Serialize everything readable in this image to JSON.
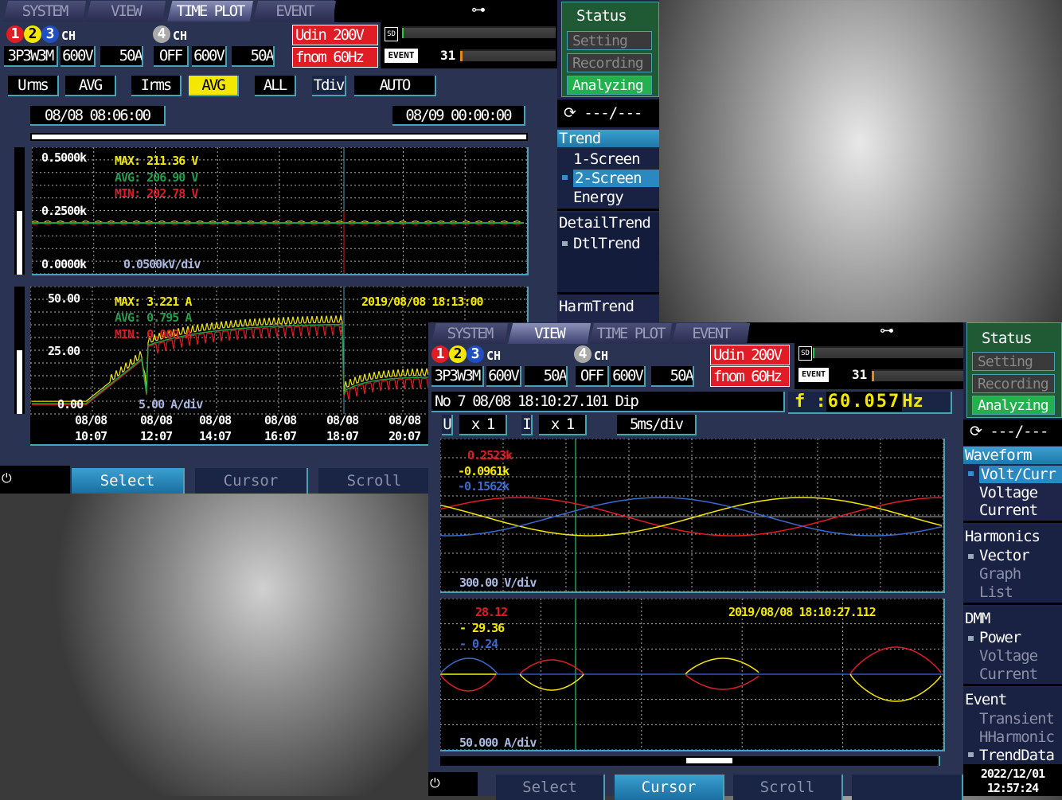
{
  "tabs": [
    "SYSTEM",
    "VIEW",
    "TIME PLOT",
    "EVENT"
  ],
  "channels": {
    "d1": "1",
    "d2": "2",
    "d3": "3",
    "d4": "4",
    "ch": "CH",
    "wiring": "3P3W3M",
    "voltage": "600V",
    "current": "50A",
    "ch4_wiring": "OFF",
    "ch4_voltage": "600V",
    "ch4_current": "50A"
  },
  "udin": "Udin 200V",
  "fnom": "fnom  60Hz",
  "sd": "SD",
  "event": "EVENT",
  "event_count": "31",
  "colors": {
    "red": "#e01c24",
    "yellow": "#f5e800",
    "blue": "#3a6ad0",
    "green": "#1fa04a"
  },
  "screen_a": {
    "controls": {
      "u": "Urms",
      "u_mode": "AVG",
      "i": "Irms",
      "i_mode": "AVG",
      "all": "ALL",
      "tdiv": "Tdiv",
      "tdiv_val": "AUTO"
    },
    "start": "08/08 08:06:00",
    "end": "08/09 00:00:00",
    "plot1": {
      "y_top": "0.5000k",
      "y_mid": "0.2500k",
      "y_bot": "0.0000k",
      "div": "0.0500kV/div",
      "max": "MAX: 211.36 V",
      "avg": "AVG: 206.90 V",
      "min": "MIN: 202.78 V"
    },
    "plot2": {
      "y_top": "50.00",
      "y_mid": "25.00",
      "y_bot": "0.00",
      "div": "5.00 A/div",
      "max": "MAX:  3.221 A",
      "avg": "AVG:  0.795 A",
      "min": "MIN:  0.000 A",
      "timestamp": "2019/08/08 18:13:00"
    },
    "xticks": [
      {
        "d": "08/08",
        "t": "10:07"
      },
      {
        "d": "08/08",
        "t": "12:07"
      },
      {
        "d": "08/08",
        "t": "14:07"
      },
      {
        "d": "08/08",
        "t": "16:07"
      },
      {
        "d": "08/08",
        "t": "18:07"
      },
      {
        "d": "08/08",
        "t": "20:07"
      }
    ],
    "buttons": [
      "Select",
      "Cursor",
      "Scroll"
    ],
    "side": {
      "status": "Status",
      "setting": "Setting",
      "recording": "Recording",
      "analyzing": "Analyzing",
      "counter": "---/---",
      "trend": "Trend",
      "s1": "1-Screen",
      "s2": "2-Screen",
      "energy": "Energy",
      "detail": "DetailTrend",
      "dtl": "DtlTrend",
      "harm": "HarmTrend"
    }
  },
  "screen_b": {
    "event_info": "No   7 08/08 18:10:27.101 Dip",
    "freq_label": "f :",
    "freq": "60.057",
    "freq_unit": "Hz",
    "u": "U",
    "u_scale": "x 1",
    "i": "I",
    "i_scale": "x 1",
    "tdiv": "5ms/div",
    "plot3": {
      "v1": "0.2523k",
      "v2": "-0.0961k",
      "v3": "-0.1562k",
      "div": "300.00 V/div"
    },
    "plot4": {
      "v1": "28.12",
      "v2": "- 29.36",
      "v3": "-  0.24",
      "div": "50.000 A/div",
      "timestamp": "2019/08/08 18:10:27.112"
    },
    "buttons": [
      "Select",
      "Cursor",
      "Scroll"
    ],
    "side": {
      "status": "Status",
      "setting": "Setting",
      "recording": "Recording",
      "analyzing": "Analyzing",
      "counter": "---/---",
      "waveform": "Waveform",
      "volt_curr": "Volt/Curr",
      "voltage": "Voltage",
      "current": "Current",
      "harmonics": "Harmonics",
      "vector": "Vector",
      "graph": "Graph",
      "list": "List",
      "dmm": "DMM",
      "power": "Power",
      "dmm_voltage": "Voltage",
      "dmm_current": "Current",
      "event": "Event",
      "transient": "Transient",
      "hharmonic": "HHarmonic",
      "trenddata": "TrendData",
      "date": "2022/12/01",
      "time": "12:57:24"
    }
  }
}
